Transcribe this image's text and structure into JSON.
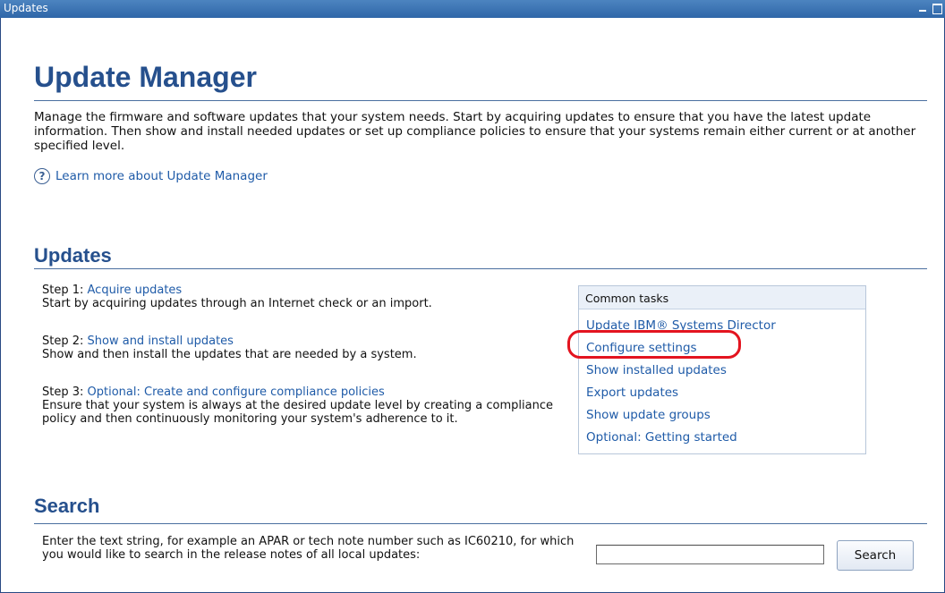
{
  "window": {
    "title": "Updates"
  },
  "page": {
    "title": "Update Manager",
    "intro": "Manage the firmware and software updates that your system needs. Start by acquiring updates to ensure that you have the latest update information. Then show and install needed updates or set up compliance policies to ensure that your systems remain either current or at another specified level.",
    "learn_more": "Learn more about Update Manager",
    "help_icon_glyph": "?"
  },
  "updates": {
    "heading": "Updates",
    "steps": [
      {
        "prefix": "Step 1: ",
        "link": "Acquire updates",
        "desc": "Start by acquiring updates through an Internet check or an import."
      },
      {
        "prefix": "Step 2: ",
        "link": "Show and install updates",
        "desc": "Show and then install the updates that are needed by a system."
      },
      {
        "prefix": "Step 3: ",
        "link": "Optional: Create and configure compliance policies",
        "desc": "Ensure that your system is always at the desired update level by creating a compliance policy and then continuously monitoring your system's adherence to it."
      }
    ]
  },
  "common_tasks": {
    "header": "Common tasks",
    "items": [
      "Update IBM® Systems Director",
      "Configure settings",
      "Show installed updates",
      "Export updates",
      "Show update groups",
      "Optional: Getting started"
    ],
    "highlighted_item": "Configure settings",
    "highlight_color": "#e3141f"
  },
  "search": {
    "heading": "Search",
    "desc": "Enter the text string, for example an APAR or tech note number such as IC60210, for which you would like to search in the release notes of all local updates:",
    "input_value": "",
    "button_label": "Search"
  },
  "colors": {
    "heading": "#26508d",
    "link": "#1f5ba8",
    "titlebar": "#3a70b0"
  }
}
